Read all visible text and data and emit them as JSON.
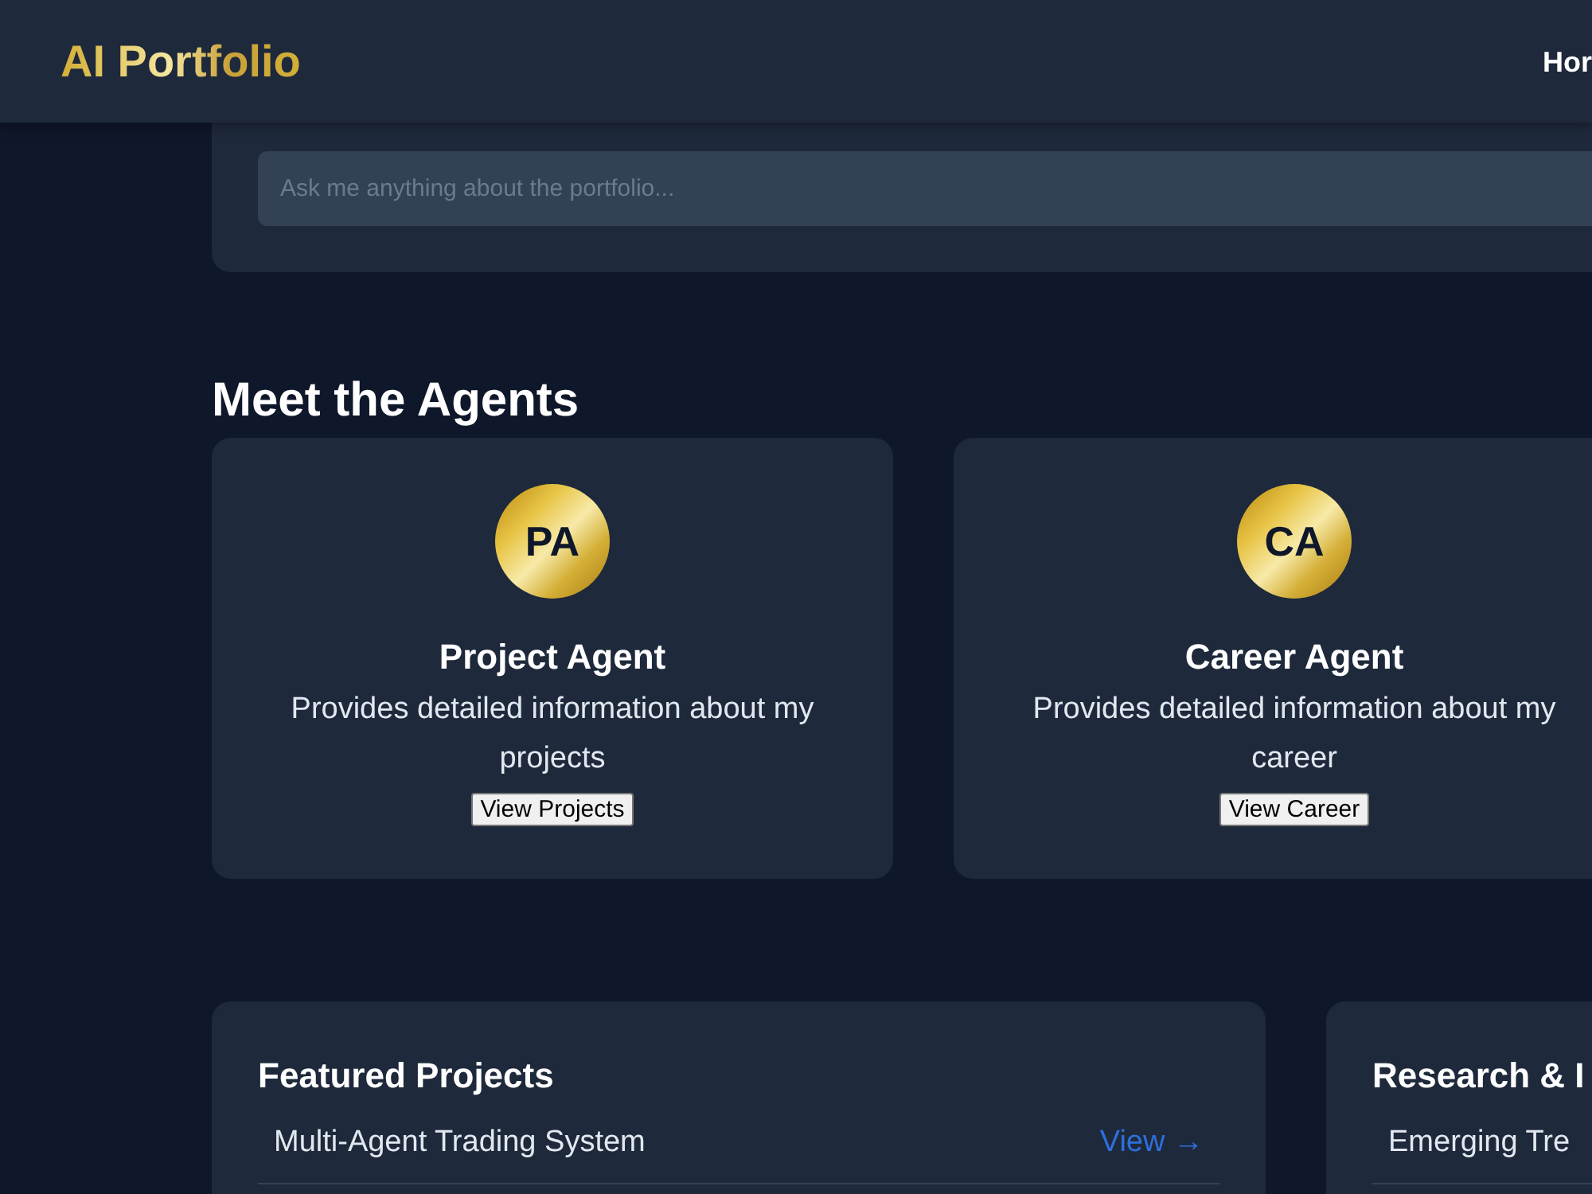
{
  "header": {
    "logo": "AI Portfolio",
    "nav": [
      {
        "label": "Hor"
      }
    ]
  },
  "chat": {
    "placeholder": "Ask me anything about the portfolio..."
  },
  "agents_section": {
    "title": "Meet the Agents",
    "agents": [
      {
        "initials": "PA",
        "name": "Project Agent",
        "description": "Provides detailed information about my projects",
        "button": "View Projects"
      },
      {
        "initials": "CA",
        "name": "Career Agent",
        "description": "Provides detailed information about my career",
        "button": "View Career"
      }
    ]
  },
  "panels": [
    {
      "title": "Featured Projects",
      "items": [
        {
          "label": "Multi-Agent Trading System",
          "link": "View →"
        }
      ]
    },
    {
      "title": "Research & I",
      "items": [
        {
          "label": "Emerging Tre"
        }
      ]
    }
  ]
}
